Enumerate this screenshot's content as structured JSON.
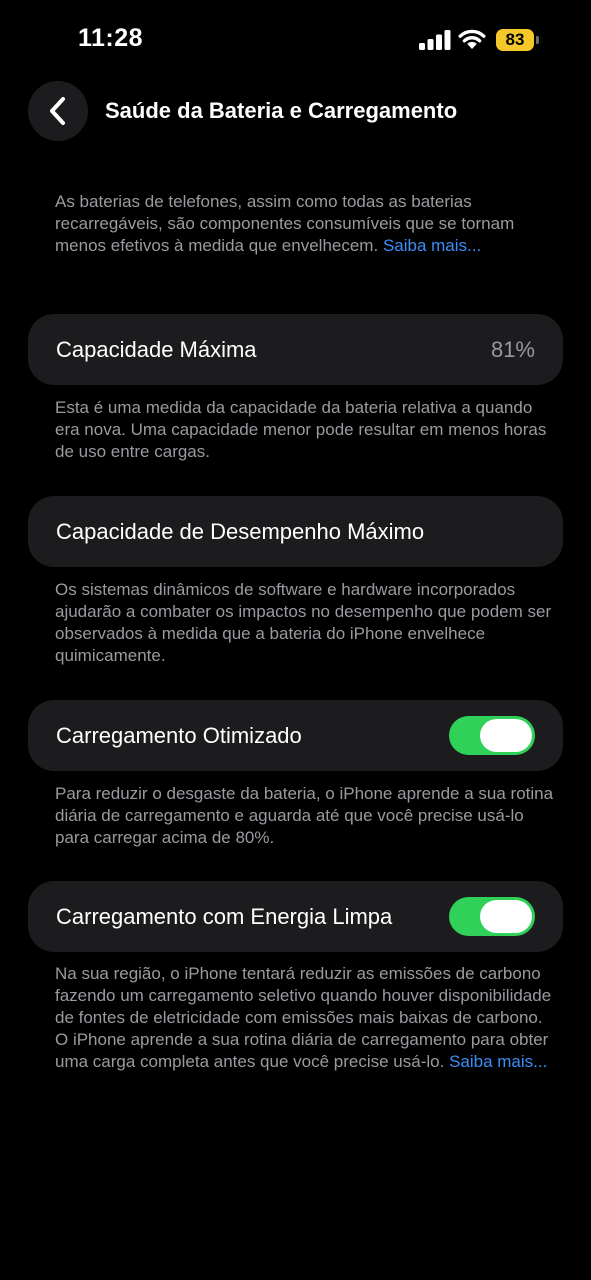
{
  "status_bar": {
    "time": "11:28",
    "battery_level": "83",
    "battery_color": "#f4c72a"
  },
  "header": {
    "title": "Saúde da Bateria e Carregamento",
    "back_icon": "chevron-left-icon"
  },
  "intro": {
    "text": "As baterias de telefones, assim como todas as baterias recarregáveis, são componentes consumíveis que se tornam menos efetivos à medida que envelhecem.",
    "link": "Saiba mais..."
  },
  "max_capacity": {
    "label": "Capacidade Máxima",
    "value": "81%",
    "description": "Esta é uma medida da capacidade da bateria relativa a quando era nova. Uma capacidade menor pode resultar em menos horas de uso entre cargas."
  },
  "peak_performance": {
    "label": "Capacidade de Desempenho Máximo",
    "description": "Os sistemas dinâmicos de software e hardware incorporados ajudarão a combater os impactos no desempenho que podem ser observados à medida que a bateria do iPhone envelhece quimicamente."
  },
  "optimized_charging": {
    "label": "Carregamento Otimizado",
    "enabled": true,
    "description": "Para reduzir o desgaste da bateria, o iPhone aprende a sua rotina diária de carregamento e aguarda até que você precise usá-lo para carregar acima de 80%."
  },
  "clean_energy": {
    "label": "Carregamento com Energia Limpa",
    "enabled": true,
    "description": "Na sua região, o iPhone tentará reduzir as emissões de carbono fazendo um carregamento seletivo quando houver disponibilidade de fontes de eletricidade com emissões mais baixas de carbono. O iPhone aprende a sua rotina diária de carregamento para obter uma carga completa antes que você precise usá-lo.",
    "link": "Saiba mais..."
  },
  "colors": {
    "background": "#000000",
    "card": "#1c1c1e",
    "toggle_on": "#30d158",
    "link": "#3b8ef7",
    "secondary_text": "#9a9aa0"
  }
}
